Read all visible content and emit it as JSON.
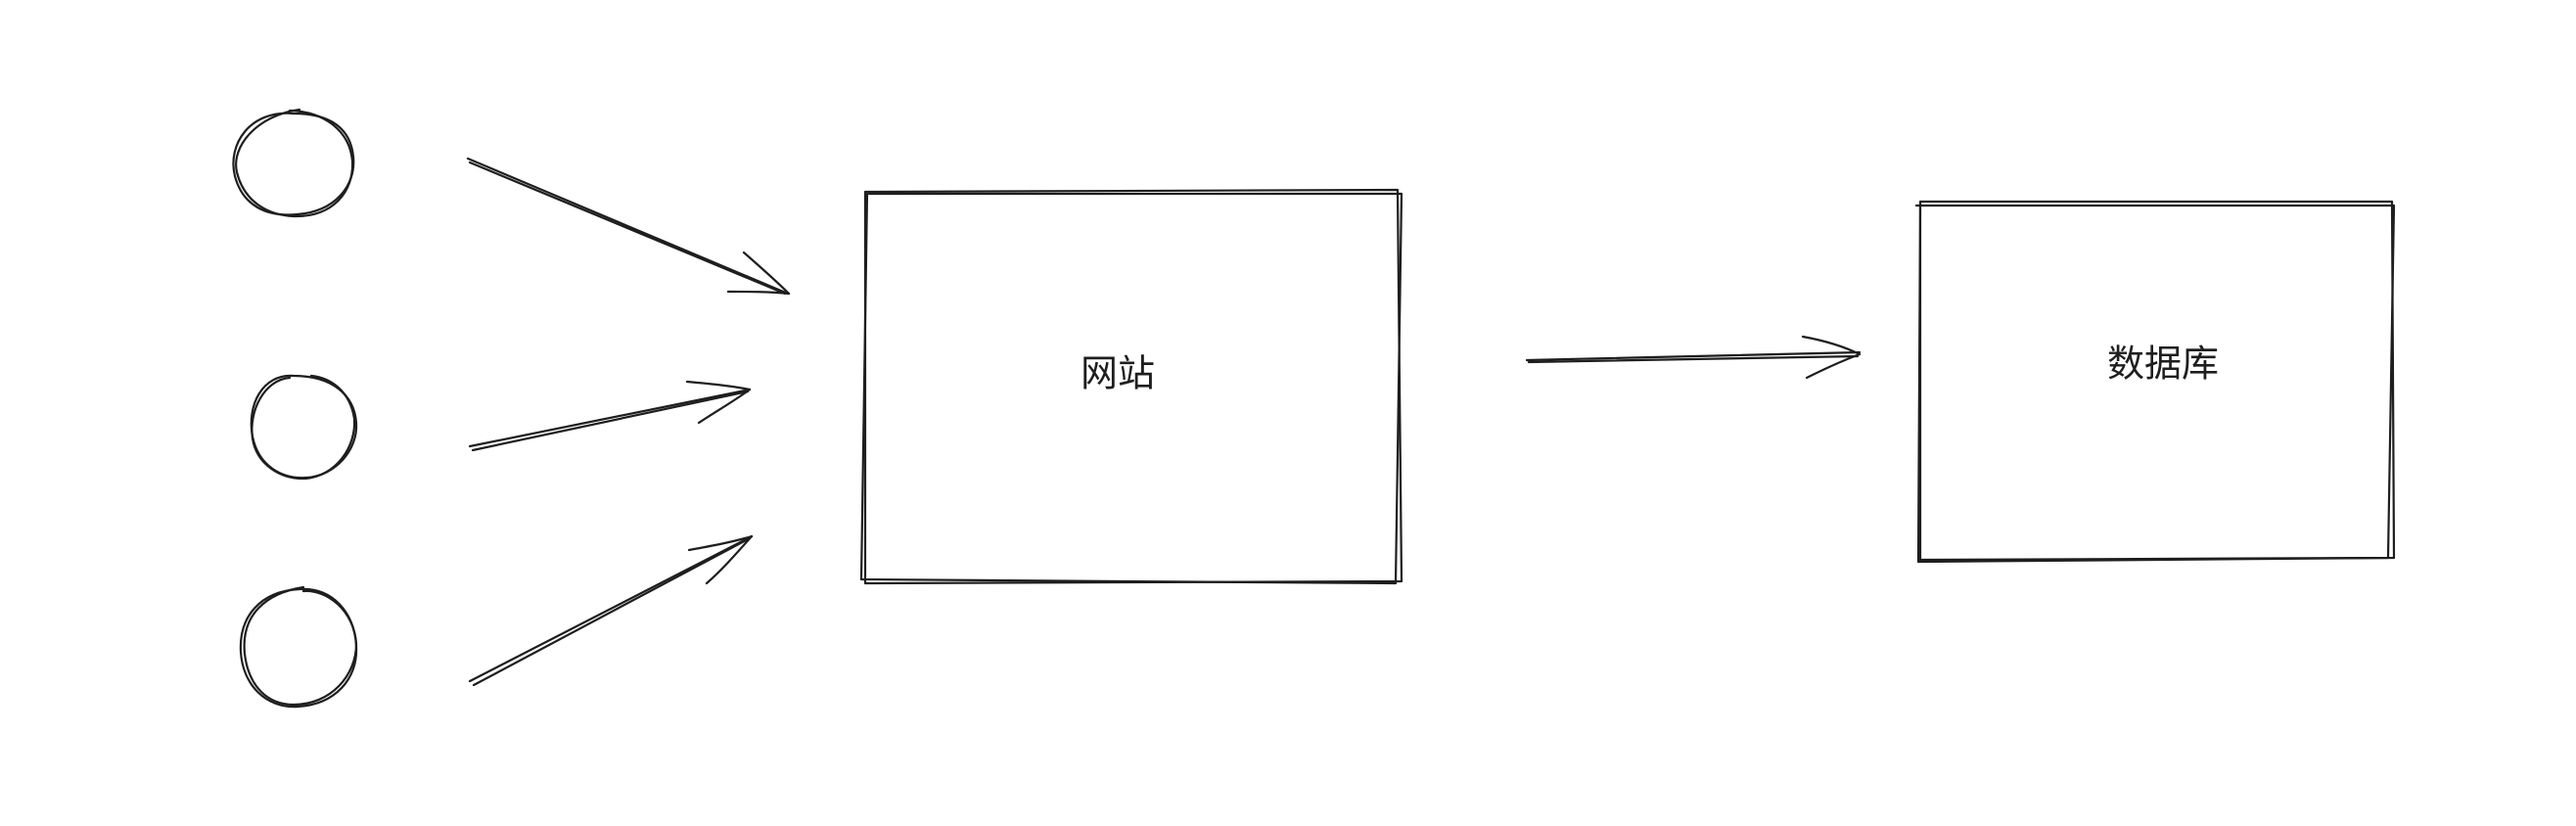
{
  "diagram": {
    "nodes": [
      {
        "id": "client-1",
        "shape": "circle",
        "label": ""
      },
      {
        "id": "client-2",
        "shape": "circle",
        "label": ""
      },
      {
        "id": "client-3",
        "shape": "circle",
        "label": ""
      },
      {
        "id": "website",
        "shape": "rectangle",
        "label": "网站"
      },
      {
        "id": "database",
        "shape": "rectangle",
        "label": "数据库"
      }
    ],
    "edges": [
      {
        "from": "client-1",
        "to": "website"
      },
      {
        "from": "client-2",
        "to": "website"
      },
      {
        "from": "client-3",
        "to": "website"
      },
      {
        "from": "website",
        "to": "database"
      }
    ],
    "stroke_color": "#1e1e1e",
    "background_color": "#ffffff"
  }
}
